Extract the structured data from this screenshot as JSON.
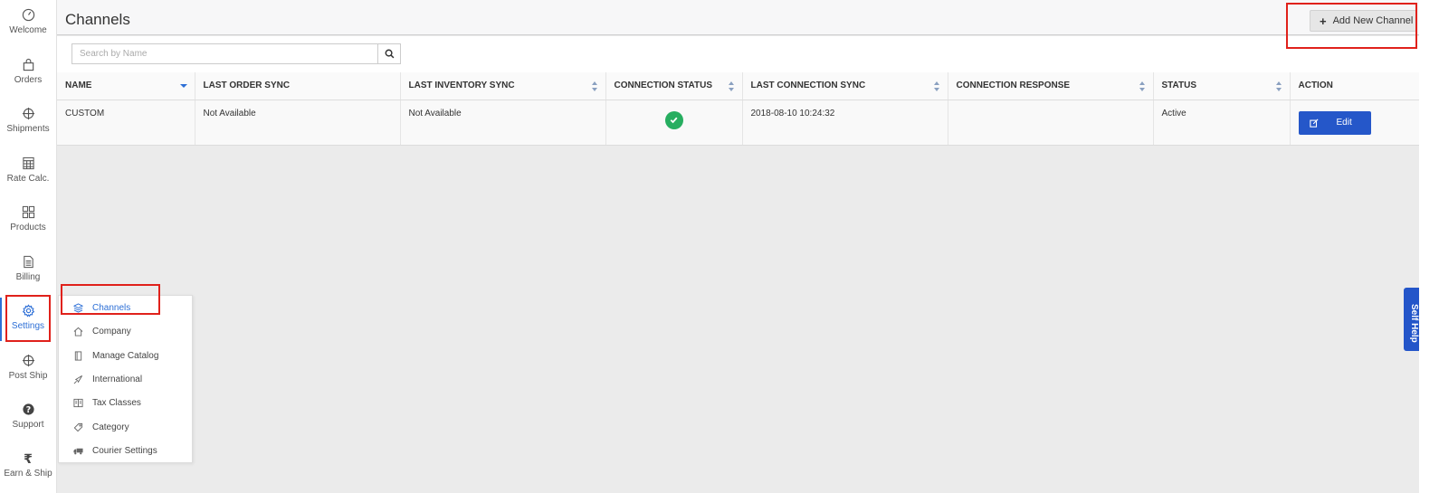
{
  "app": {
    "page_title": "Channels",
    "add_button": "Add New Channel"
  },
  "nav": [
    {
      "label": "Welcome",
      "icon": "dashboard-icon"
    },
    {
      "label": "Orders",
      "icon": "bag-icon"
    },
    {
      "label": "Shipments",
      "icon": "crosshair-icon"
    },
    {
      "label": "Rate Calc.",
      "icon": "calculator-icon"
    },
    {
      "label": "Products",
      "icon": "grid-icon"
    },
    {
      "label": "Billing",
      "icon": "document-icon"
    },
    {
      "label": "Settings",
      "icon": "gear-icon"
    },
    {
      "label": "Post Ship",
      "icon": "crosshair-icon"
    },
    {
      "label": "Support",
      "icon": "question-icon"
    },
    {
      "label": "Earn & Ship",
      "icon": "rupee-icon"
    }
  ],
  "search": {
    "placeholder": "Search by Name",
    "value": ""
  },
  "table": {
    "columns": [
      "NAME",
      "LAST ORDER SYNC",
      "LAST INVENTORY SYNC",
      "CONNECTION STATUS",
      "LAST CONNECTION SYNC",
      "CONNECTION RESPONSE",
      "STATUS",
      "ACTION"
    ],
    "rows": [
      {
        "name": "CUSTOM",
        "last_order_sync": "Not Available",
        "last_inventory_sync": "Not Available",
        "connection_status": "connected",
        "last_connection_sync": "2018-08-10 10:24:32",
        "connection_response": "",
        "status": "Active",
        "action": "Edit"
      }
    ]
  },
  "settings_menu": [
    {
      "label": "Channels",
      "icon": "layers-icon"
    },
    {
      "label": "Company",
      "icon": "home-icon"
    },
    {
      "label": "Manage Catalog",
      "icon": "book-icon"
    },
    {
      "label": "International",
      "icon": "plane-icon"
    },
    {
      "label": "Tax Classes",
      "icon": "columns-icon"
    },
    {
      "label": "Category",
      "icon": "tag-icon"
    },
    {
      "label": "Courier Settings",
      "icon": "truck-icon"
    }
  ],
  "self_help": "Self Help",
  "colors": {
    "accent": "#2d6fd6",
    "button": "#2557c9",
    "success": "#27ae60",
    "highlight": "#e0211b"
  }
}
